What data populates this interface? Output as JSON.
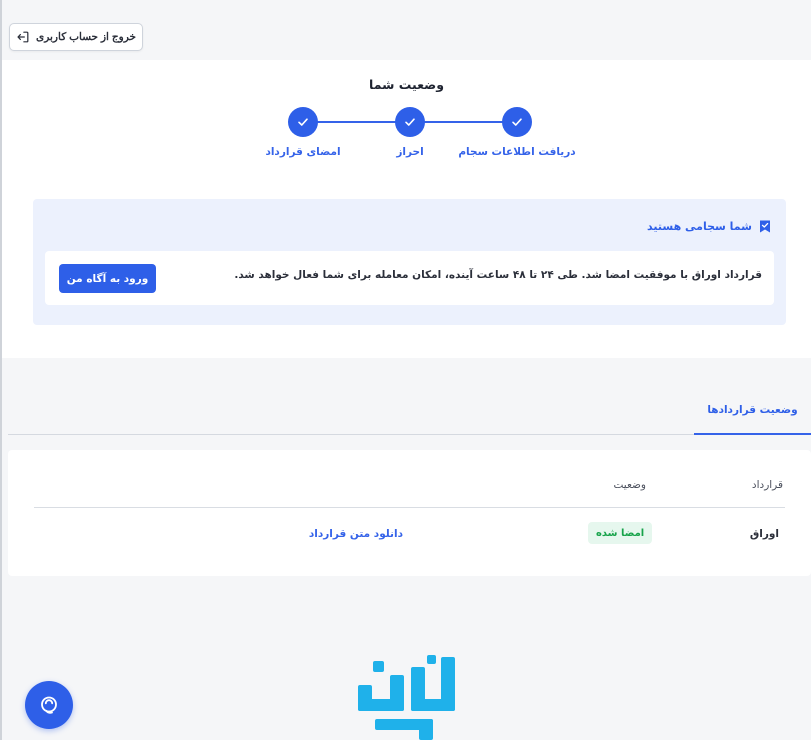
{
  "header": {
    "logout_label": "خروج از حساب کاربری",
    "logout_icon": "logout-icon"
  },
  "status": {
    "title": "وضعیت شما",
    "steps": [
      {
        "label": "دریافت اطلاعات سجام",
        "done": true
      },
      {
        "label": "احراز",
        "done": true
      },
      {
        "label": "امضای قرارداد",
        "done": true
      }
    ],
    "accent_color": "#2e5fe8"
  },
  "notice": {
    "heading": "شما سجامی هستید",
    "heading_icon": "bookmark-icon",
    "message": "قرارداد اوراق با موفقیت امضا شد. طی ۲۴ تا ۴۸ ساعت آینده، امکان معامله برای شما فعال خواهد شد.",
    "button_label": "ورود به آگاه من"
  },
  "tabs": {
    "active_label": "وضعیت قراردادها"
  },
  "contracts": {
    "columns": [
      "قرارداد",
      "وضعیت"
    ],
    "rows": [
      {
        "contract": "اوراق",
        "status": "امضا شده",
        "action": "دانلود متن قرارداد"
      }
    ],
    "status_color": "#17a34a"
  },
  "support": {
    "icon": "support-chat-icon"
  }
}
